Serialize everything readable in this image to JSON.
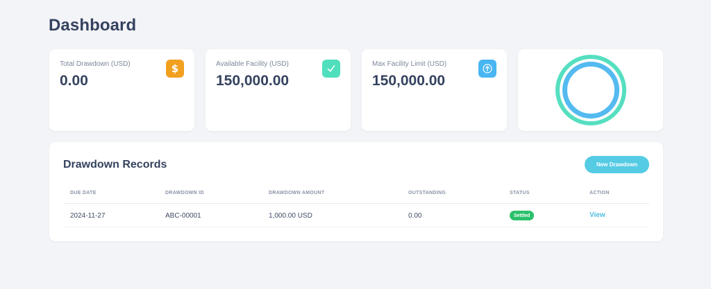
{
  "page": {
    "title": "Dashboard"
  },
  "colors": {
    "drawdown_icon": "#f2a020",
    "available_icon": "#4fdfbd",
    "max_icon": "#48b6f2",
    "ring_outer": "#55dfc0",
    "ring_inner": "#54baf0",
    "settled_badge": "#2bc06b",
    "accent_button": "#55cbe4"
  },
  "cards": [
    {
      "label": "Total Drawdown (USD)",
      "value": "0.00",
      "icon": "dollar-icon"
    },
    {
      "label": "Available Facility (USD)",
      "value": "150,000.00",
      "icon": "check-icon"
    },
    {
      "label": "Max Facility Limit (USD)",
      "value": "150,000.00",
      "icon": "arrow-up-icon"
    }
  ],
  "records": {
    "title": "Drawdown Records",
    "new_button": "New Drawdown",
    "columns": [
      "DUE DATE",
      "DRAWDOWN ID",
      "DRAWDOWN AMOUNT",
      "OUTSTANDING",
      "STATUS",
      "ACTION"
    ],
    "rows": [
      {
        "due_date": "2024-11-27",
        "drawdown_id": "ABC-00001",
        "amount": "1,000.00 USD",
        "outstanding": "0.00",
        "status": "Settled",
        "action": "View"
      }
    ]
  }
}
